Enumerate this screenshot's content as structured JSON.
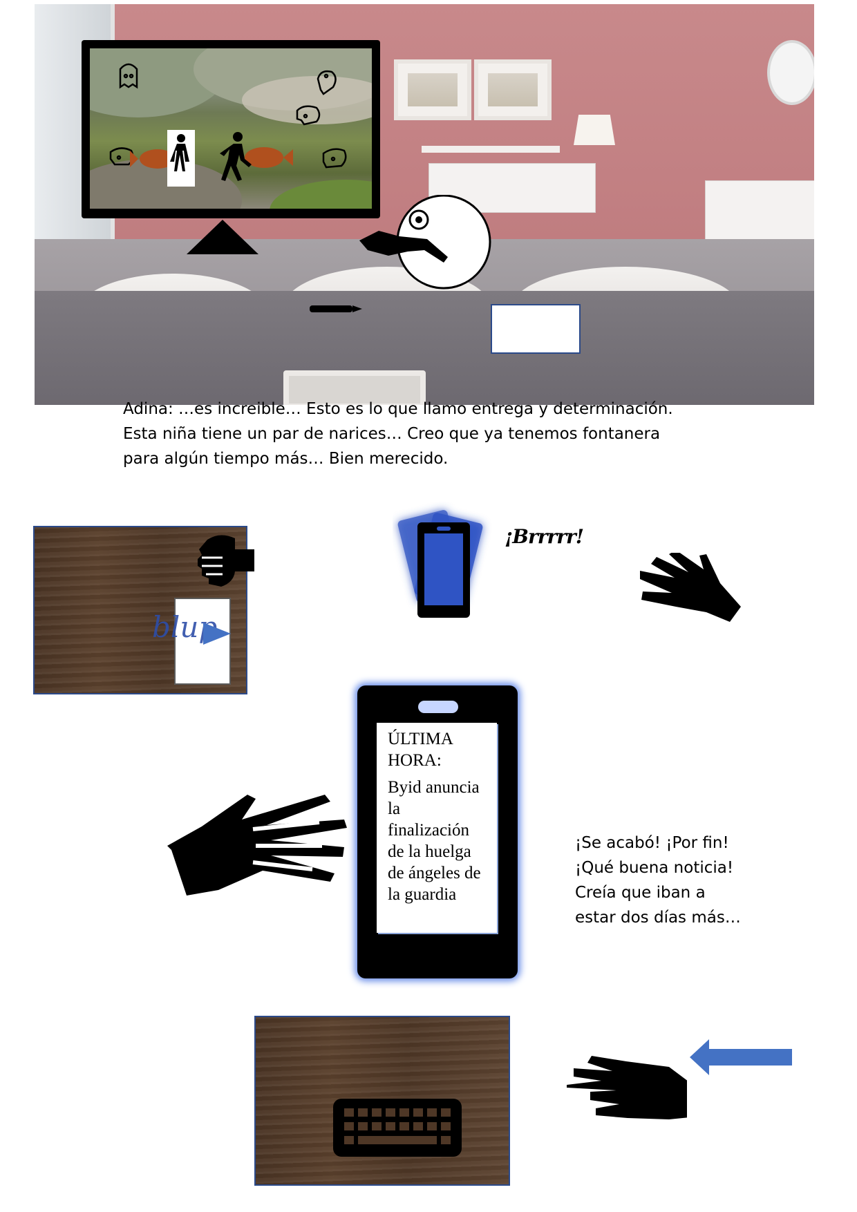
{
  "panel_office": {
    "scene": "office-meeting-room",
    "monitor_icons": [
      "ghost-icon",
      "person-walking-icon",
      "fish-icon",
      "woman-icon"
    ]
  },
  "dialogue_1": {
    "speaker": "Adina",
    "lines": [
      "Adina: …es increible… Esto es lo que llamo entrega y determinación.",
      "Esta niña tiene un par de narices… Creo que ya tenemos fontanera",
      "para algún tiempo más… Bien merecido."
    ]
  },
  "phone_sound": "¡Brrrrr!",
  "doodle_text": "blup",
  "phone_news": {
    "title_lines": [
      "ÚLTIMA",
      "HORA:"
    ],
    "body_lines": [
      "Byid anuncia",
      "la",
      "finalización",
      "de la huelga",
      "de ángeles de",
      "la guardia"
    ]
  },
  "dialogue_2": {
    "lines": [
      "¡Se acabó! ¡Por fin!",
      "¡Qué buena noticia!",
      "Creía que iban a",
      "estar dos días más…"
    ]
  },
  "colors": {
    "wall": "#c07d80",
    "phone_glow": "#6a8ee8",
    "arrow": "#4472c4",
    "wood": "#4e3726",
    "fish": "#b0501e"
  }
}
